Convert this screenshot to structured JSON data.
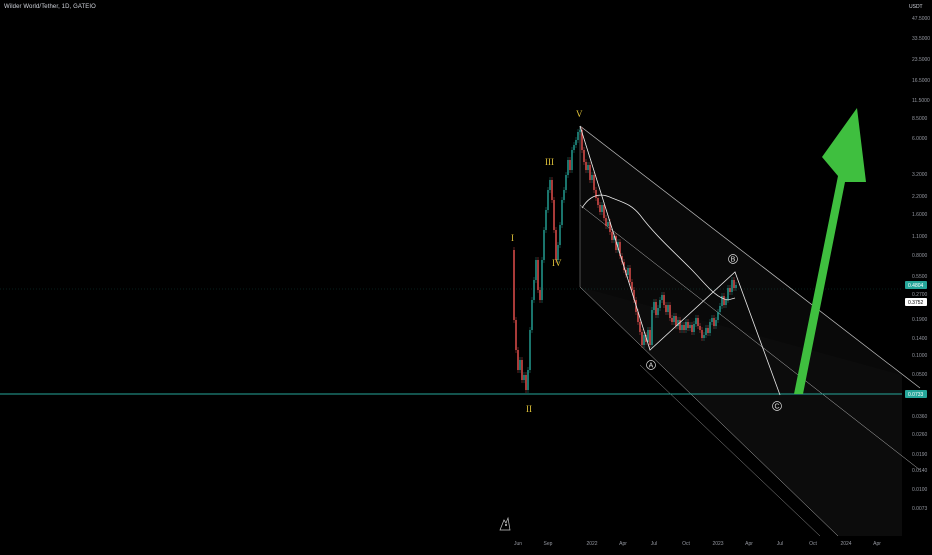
{
  "header": {
    "symbol_title": "Wilder World/Tether, 1D, GATEIO"
  },
  "price_axis": {
    "currency": "USDT",
    "ticks": [
      "47.5000",
      "33.5000",
      "23.5000",
      "16.5000",
      "11.5000",
      "8.5000",
      "6.0000",
      "3.2000",
      "2.2000",
      "1.6000",
      "1.1000",
      "0.8000",
      "0.5500",
      "0.2700",
      "0.1900",
      "0.1400",
      "0.1000",
      "0.0500",
      "0.0360",
      "0.0260",
      "0.0190",
      "0.0140",
      "0.0100",
      "0.0073"
    ]
  },
  "price_tags": [
    {
      "label": "0.4804",
      "bg": "#26a69a",
      "fg": "#ffffff"
    },
    {
      "label": "0.3752",
      "bg": "#ffffff",
      "fg": "#000000"
    },
    {
      "label": "0.0733",
      "bg": "#26a69a",
      "fg": "#ffffff"
    }
  ],
  "time_axis": {
    "ticks": [
      "Jun",
      "Sep",
      "2022",
      "Apr",
      "Jul",
      "Oct",
      "2023",
      "Apr",
      "Jul",
      "Oct",
      "2024",
      "Apr"
    ]
  },
  "wave_labels": [
    "I",
    "II",
    "III",
    "IV",
    "V"
  ],
  "abc_labels": [
    "A",
    "B",
    "C"
  ],
  "colors": {
    "background": "#000000",
    "up_candle": "#26a69a",
    "down_candle": "#ef5350",
    "support_line": "#26a69a",
    "wave_label": "#e3c53a",
    "projection_arrow": "#3fbf3f",
    "channel_line": "#bdbdbd"
  },
  "icons": {
    "watermark": "tradingview-logo-icon",
    "projection": "up-arrow-icon"
  }
}
